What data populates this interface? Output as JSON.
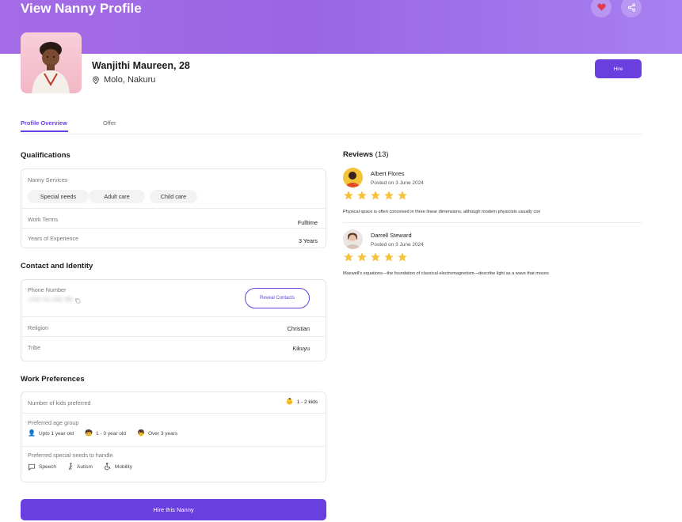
{
  "header": {
    "title": "View Nanny Profile"
  },
  "profile": {
    "name": "Wanjithi Maureen, 28",
    "location": "Molo, Nakuru",
    "hire_label": "Hire"
  },
  "tabs": [
    {
      "label": "Profile Overview"
    },
    {
      "label": "Offer"
    }
  ],
  "qualifications": {
    "title": "Qualifications",
    "services_label": "Nanny Services",
    "services": [
      "Special needs",
      "Adult care",
      "Child care"
    ],
    "work_terms_label": "Work Terms",
    "work_terms": "Fulltime",
    "experience_label": "Years of Experience",
    "experience": "3 Years"
  },
  "contact": {
    "title": "Contact and Identity",
    "phone_label": "Phone Number",
    "phone_value": "+254 701 456 789",
    "reveal_label": "Reveal Contacts",
    "religion_label": "Religion",
    "religion": "Christian",
    "tribe_label": "Tribe",
    "tribe": "Kikuyu"
  },
  "preferences": {
    "title": "Work Preferences",
    "kids_label": "Number of kids preferred",
    "kids_value": "1 - 2 kids",
    "age_label": "Preferred age group",
    "ages": [
      "Upto 1 year old",
      "1 - 3 year old",
      "Over 3 years"
    ],
    "needs_label": "Preferred special needs to handle",
    "needs": [
      "Speech",
      "Autism",
      "Mobility"
    ]
  },
  "hire_bottom_label": "Hire this Nanny",
  "reviews": {
    "title": "Reviews",
    "count": "(13)",
    "items": [
      {
        "name": "Albert Flores",
        "date": "Posted on 3 June 2024",
        "rating": 5,
        "text": "Physical space is often conceived in three linear dimensions, although modern physicists usually con"
      },
      {
        "name": "Darrell Steward",
        "date": "Posted on 3 June 2024",
        "rating": 5,
        "text": "Maxwell's equations—the foundation of classical electromagnetism—describe light as a wave that moves"
      }
    ]
  },
  "colors": {
    "accent": "#6a3fe0",
    "header_gradient_start": "#a56be6",
    "star": "#f5c33b"
  }
}
